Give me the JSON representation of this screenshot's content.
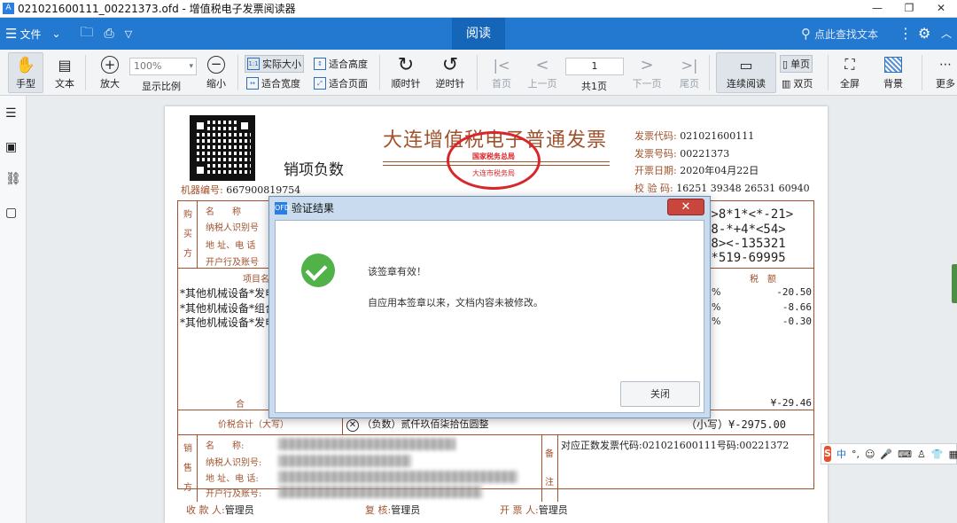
{
  "window": {
    "title": "021021600111_00221373.ofd - 增值税电子发票阅读器"
  },
  "menu": {
    "file": "文件",
    "read_tab": "阅读",
    "search_placeholder": "点此查找文本"
  },
  "toolbar": {
    "hand": "手型",
    "text": "文本",
    "zoom_in": "放大",
    "zoom_value": "100%",
    "display_ratio": "显示比例",
    "zoom_out": "缩小",
    "actual_size": "实际大小",
    "fit_height": "适合高度",
    "fit_width": "适合宽度",
    "fit_page": "适合页面",
    "rotate_cw": "顺时针",
    "rotate_ccw": "逆时针",
    "first_page": "首页",
    "prev_page": "上一页",
    "page_number": "1",
    "page_total": "共1页",
    "next_page": "下一页",
    "last_page": "尾页",
    "continuous": "连续阅读",
    "single": "单页",
    "double": "双页",
    "fullscreen": "全屏",
    "background": "背景",
    "more": "更多"
  },
  "invoice": {
    "title": "大连增值税电子普通发票",
    "subtitle": "销项负数",
    "code_label": "发票代码:",
    "code": "021021600111",
    "number_label": "发票号码:",
    "number": "00221373",
    "date_label": "开票日期:",
    "date": "2020年04月22日",
    "check_label": "校 验 码:",
    "check": "16251 39348 26531 60940",
    "machine_label": "机器编号:",
    "machine": "667900819754",
    "stamp_top": "国家税务总局",
    "stamp_bottom": "大连市税务局",
    "buyer_side": [
      "购",
      "买",
      "方"
    ],
    "buyer_fields": [
      "名　　称",
      "纳税人识别号",
      "地 址、电 话",
      "开户行及账号"
    ],
    "cipher": [
      "3>8*1*<*-21>",
      "38-*+4*<54>",
      "18><-135321",
      "4*519-69995"
    ],
    "items_header": "项目名",
    "tax_header": "税　额",
    "items": [
      "*其他机械设备*发电",
      "*其他机械设备*组合",
      "*其他机械设备*发电"
    ],
    "taxes": [
      "-20.50",
      "-8.66",
      "-0.30"
    ],
    "total_label": "合",
    "total_tax": "¥-29.46",
    "sum_label": "价税合计（大写）",
    "sum_words": "（负数）贰仟玖佰柒拾伍圆整",
    "sum_small": "（小写）¥-2975.00",
    "seller_side": [
      "销",
      "售",
      "方"
    ],
    "seller_fields": [
      "名　　称:",
      "纳税人识别号:",
      "地 址、电 话:",
      "开户行及账号:"
    ],
    "remark_side": [
      "备",
      "注"
    ],
    "remark": "对应正数发票代码:021021600111号码:00221372",
    "payee_label": "收 款 人:",
    "payee": "管理员",
    "reviewer_label": "复 核:",
    "reviewer": "管理员",
    "drawer_label": "开 票 人:",
    "drawer": "管理员"
  },
  "dialog": {
    "title": "验证结果",
    "line1": "该签章有效！",
    "line2": "自应用本签章以来，文档内容未被修改。",
    "button": "关闭"
  },
  "ime": {
    "lang": "中"
  }
}
